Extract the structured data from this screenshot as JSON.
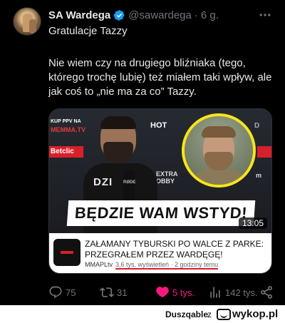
{
  "tweet": {
    "author_name": "SA Wardega",
    "handle": "@sawardega",
    "separator": "·",
    "time": "6 g.",
    "more_icon": "more-horizontal-icon",
    "text_line1": "Gratulacje Tazzy",
    "text_line2": "Nie wiem czy na drugiego bliźniaka (tego, którego trochę lubię) też miałem taki wpływ, ale jak coś to „nie ma za co” Tazzy."
  },
  "card": {
    "thumbnail": {
      "sponsor_kup": "KUP PPV NA",
      "sponsor_memma": "MEMMA.TV",
      "sponsor_betclic": "Betclic",
      "sponsor_hot": "HOT",
      "sponsor_extra": "EXTRA",
      "sponsor_obby": "OBBY",
      "sponsor_m": "m",
      "sponsor_d": "D",
      "shirt_text": "DZI",
      "mic_label": "RØDE",
      "headline": "BĘDZIE WAM WSTYD!",
      "duration": "13:05"
    },
    "title": "ZAŁAMANY TYBURSKI PO WALCE Z PARKE: PRZEGRAŁEM PRZEZ WARDĘGĘ!",
    "channel": "MMAPLtv",
    "stats": "3,6 tys. wyświetleń · 2 godziny temu"
  },
  "actions": {
    "reply_count": "75",
    "retweet_count": "31",
    "like_count": "5 tys.",
    "views_count": "142 tys."
  },
  "footer": {
    "username": "Duszqable",
    "preposition": "z",
    "site": "wykop.pl"
  },
  "colors": {
    "background": "#000000",
    "text": "#e7e9ea",
    "muted": "#71767b",
    "like": "#f91880",
    "verified": "#1d9bf0",
    "headline_border": "#f7e51a",
    "sponsor_red": "#d8202a"
  }
}
